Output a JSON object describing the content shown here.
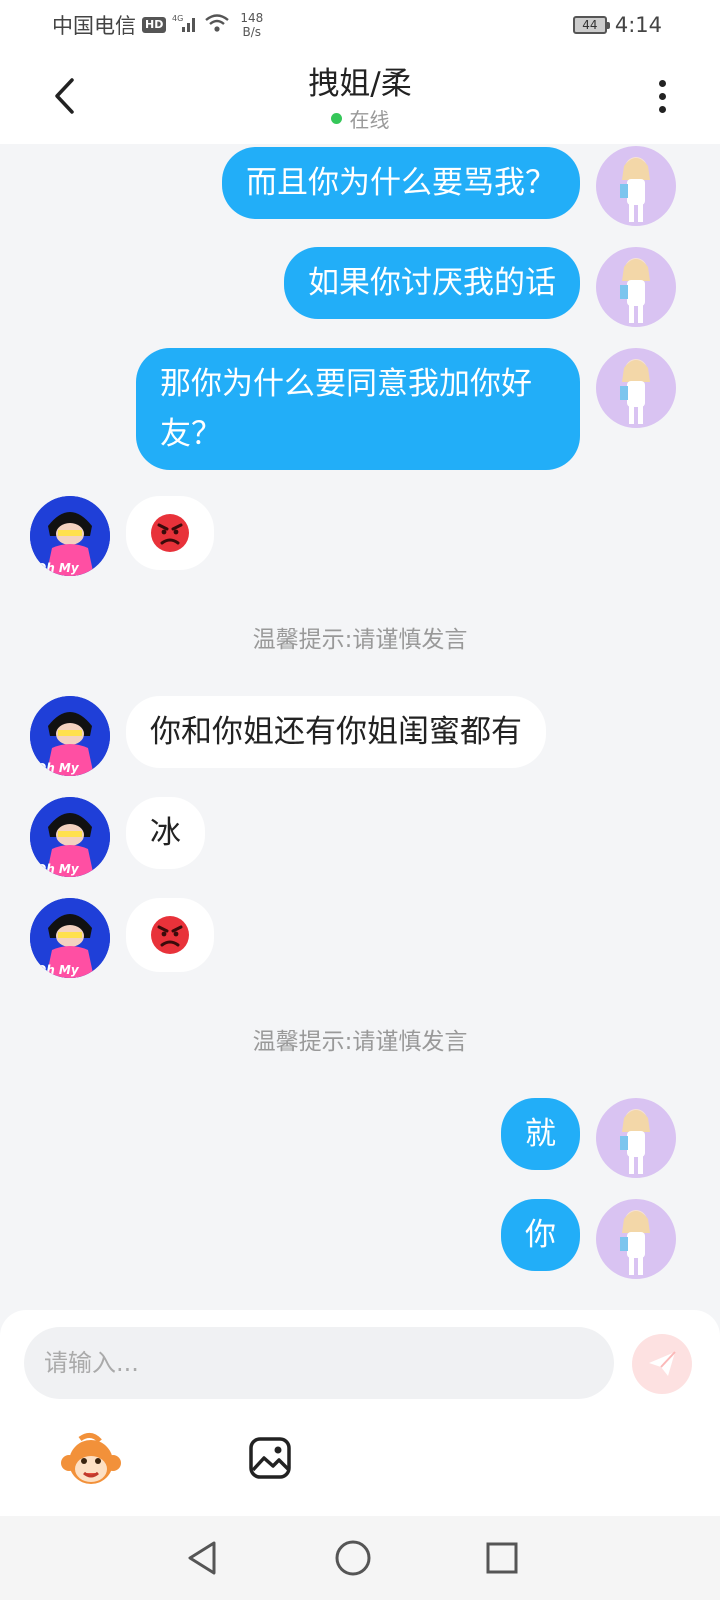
{
  "status_bar": {
    "carrier": "中国电信",
    "hd": "HD",
    "net_speed_value": "148",
    "net_speed_unit": "B/s",
    "battery": "44",
    "time": "4:14"
  },
  "header": {
    "title": "拽姐/柔",
    "status": "在线"
  },
  "messages": [
    {
      "from": "self",
      "text": "而且你为什么要骂我？"
    },
    {
      "from": "self",
      "text": "如果你讨厌我的话"
    },
    {
      "from": "self",
      "text": "那你为什么要同意我加你好友？"
    },
    {
      "from": "other",
      "emoji": "angry-face"
    },
    {
      "notice": "温馨提示:请谨慎发言"
    },
    {
      "from": "other",
      "text": "你和你姐还有你姐闺蜜都有"
    },
    {
      "from": "other",
      "text": "冰"
    },
    {
      "from": "other",
      "emoji": "angry-face"
    },
    {
      "notice": "温馨提示:请谨慎发言"
    },
    {
      "from": "self",
      "text": "就"
    },
    {
      "from": "self",
      "text": "你"
    }
  ],
  "composer": {
    "placeholder": "请输入..."
  },
  "colors": {
    "outgoing_bubble": "#22aef8",
    "incoming_bubble": "#ffffff",
    "online_dot": "#35c759",
    "send_button": "#fde1e1"
  },
  "icons": {
    "back": "chevron-left-icon",
    "more": "more-vertical-icon",
    "send": "paper-plane-icon",
    "sticker": "monkey-sticker-icon",
    "image": "image-icon",
    "nav_back": "triangle-back-icon",
    "nav_home": "circle-home-icon",
    "nav_recent": "square-recent-icon"
  }
}
